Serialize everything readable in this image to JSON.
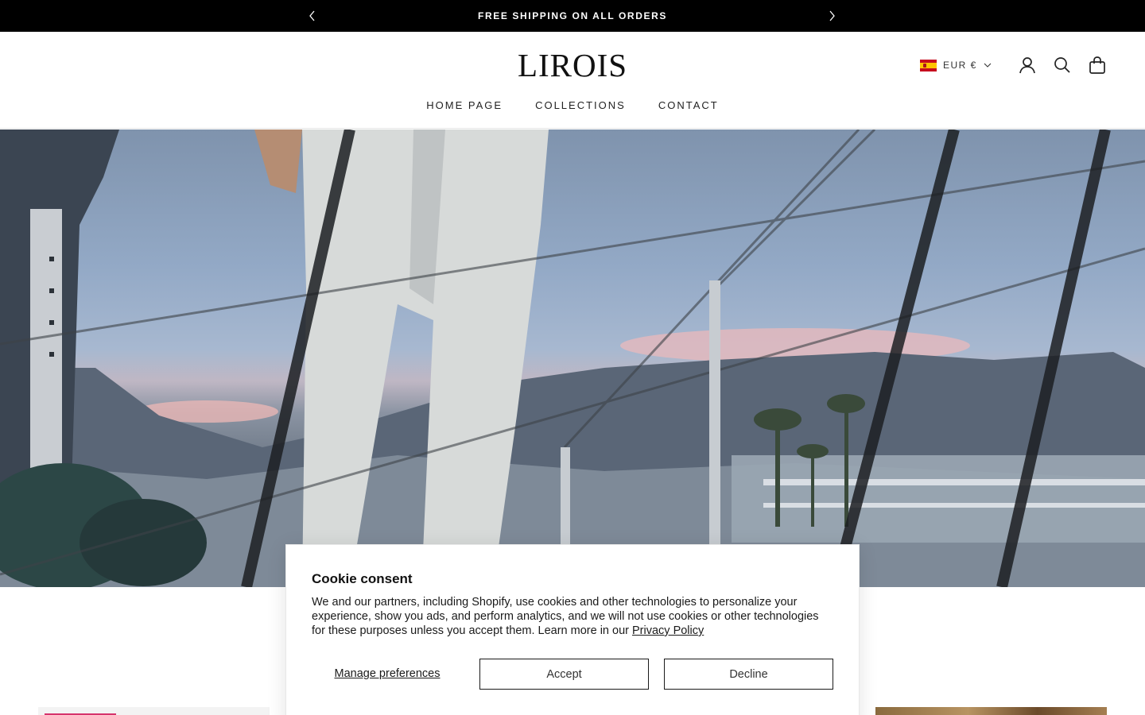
{
  "announcement": {
    "text": "FREE SHIPPING ON ALL ORDERS",
    "prev_icon": "chevron-left-icon",
    "next_icon": "chevron-right-icon"
  },
  "header": {
    "logo": "LIROIS",
    "currency": "EUR €",
    "currency_flag": "spain-flag-icon",
    "icons": [
      "account-icon",
      "search-icon",
      "cart-icon"
    ]
  },
  "nav": {
    "items": [
      {
        "label": "HOME PAGE"
      },
      {
        "label": "COLLECTIONS"
      },
      {
        "label": "CONTACT"
      }
    ]
  },
  "cookie": {
    "title": "Cookie consent",
    "body": "We and our partners, including Shopify, use cookies and other technologies to personalize your experience, show you ads, and perform analytics, and we will not use cookies or other technologies for these purposes unless you accept them. Learn more in our ",
    "link": "Privacy Policy",
    "manage": "Manage preferences",
    "accept": "Accept",
    "decline": "Decline"
  },
  "colors": {
    "announcement_bg": "#000000",
    "text": "#1a1a1a",
    "sale_badge": "#d6336c"
  }
}
